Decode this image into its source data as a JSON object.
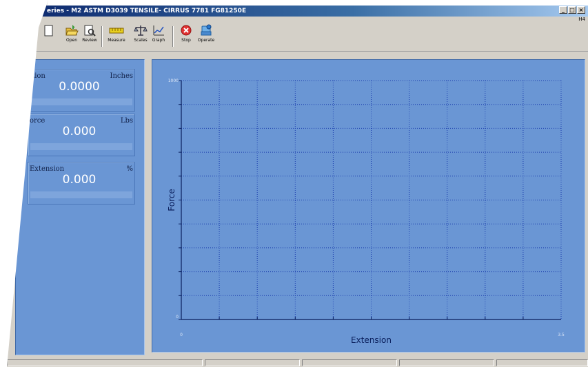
{
  "window": {
    "title": "eries - M2 ASTM D3039 TENSILE- CIRRUS 7781 FG81250E",
    "help_label": "H4"
  },
  "toolbar": {
    "items": [
      {
        "label": "",
        "icon": "blank-document-icon"
      },
      {
        "label": "Open",
        "icon": "open-folder-icon"
      },
      {
        "label": "Review",
        "icon": "review-document-icon"
      },
      {
        "label": "Measure",
        "icon": "measure-ruler-icon"
      },
      {
        "label": "Scales",
        "icon": "scales-icon"
      },
      {
        "label": "Graph",
        "icon": "graph-icon"
      },
      {
        "label": "Stop",
        "icon": "stop-icon"
      },
      {
        "label": "Operate",
        "icon": "operate-icon"
      }
    ]
  },
  "readouts": [
    {
      "name": "ition",
      "unit": "Inches",
      "value": "0.0000"
    },
    {
      "name": "orce",
      "unit": "Lbs",
      "value": "0.000"
    },
    {
      "name": "Extension",
      "unit": "%",
      "value": "0.000"
    }
  ],
  "chart_data": {
    "type": "line",
    "title": "",
    "xlabel": "Extension",
    "ylabel": "Force",
    "xlim": [
      0,
      3.5
    ],
    "ylim": [
      0,
      1000
    ],
    "x_tick_labels": [
      "0",
      "3.5"
    ],
    "y_tick_labels": [
      "0",
      "1000"
    ],
    "x_gridlines": 10,
    "y_gridlines": 10,
    "grid": true,
    "series": [],
    "colors": {
      "background": "#6a96d4",
      "grid": "#1d3fae",
      "axis": "#0a1f5c"
    }
  }
}
